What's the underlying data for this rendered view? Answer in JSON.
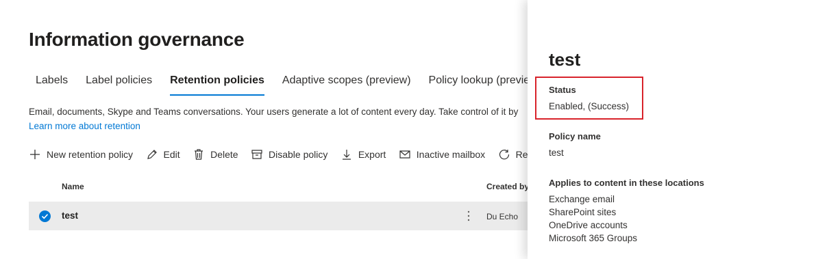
{
  "page": {
    "title": "Information governance"
  },
  "tabs": [
    {
      "label": "Labels",
      "active": false
    },
    {
      "label": "Label policies",
      "active": false
    },
    {
      "label": "Retention policies",
      "active": true
    },
    {
      "label": "Adaptive scopes (preview)",
      "active": false
    },
    {
      "label": "Policy lookup (preview)",
      "active": false
    }
  ],
  "description": "Email, documents, Skype and Teams conversations. Your users generate a lot of content every day. Take control of it by",
  "learn_more": "Learn more about retention",
  "toolbar": {
    "new_policy": "New retention policy",
    "edit": "Edit",
    "delete": "Delete",
    "disable": "Disable policy",
    "export": "Export",
    "inactive_mailbox": "Inactive mailbox",
    "refresh": "Refresh"
  },
  "table": {
    "columns": {
      "name": "Name",
      "created_by": "Created by"
    },
    "rows": [
      {
        "name": "test",
        "created_by": "Du Echo",
        "selected": true
      }
    ]
  },
  "panel": {
    "title": "test",
    "status_label": "Status",
    "status_value": "Enabled, (Success)",
    "policy_name_label": "Policy name",
    "policy_name_value": "test",
    "locations_label": "Applies to content in these locations",
    "locations": [
      "Exchange email",
      "SharePoint sites",
      "OneDrive accounts",
      "Microsoft 365 Groups"
    ]
  },
  "colors": {
    "accent": "#0078d4",
    "highlight": "#d8222a",
    "selected_row": "#ebebeb"
  }
}
